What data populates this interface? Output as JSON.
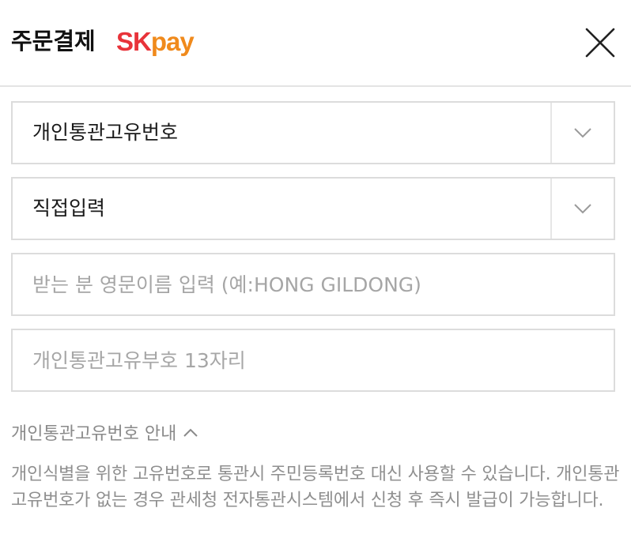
{
  "header": {
    "title": "주문결제",
    "brand_sk": "SK",
    "brand_pay": "pay"
  },
  "form": {
    "customs_type_select": {
      "value": "개인통관고유번호",
      "icon": "chevron-down-icon"
    },
    "input_method_select": {
      "value": "직접입력",
      "icon": "chevron-down-icon"
    },
    "english_name_input": {
      "value": "",
      "placeholder": "받는 분 영문이름 입력 (예:HONG GILDONG)"
    },
    "customs_number_input": {
      "value": "",
      "placeholder": "개인통관고유부호 13자리"
    }
  },
  "guide": {
    "toggle_label": "개인통관고유번호 안내",
    "toggle_icon": "chevron-up-icon",
    "text": "개인식별을 위한 고유번호로 통관시 주민등록번호 대신 사용할 수 있습니다. 개인통관고유번호가 없는 경우 관세청 전자통관시스템에서 신청 후 즉시 발급이 가능합니다."
  },
  "colors": {
    "brand_sk": "#e8333a",
    "brand_pay": "#f08a1c",
    "border": "#dcdcdc",
    "placeholder": "#a6a6a6",
    "guide_text": "#8f8f8f"
  }
}
